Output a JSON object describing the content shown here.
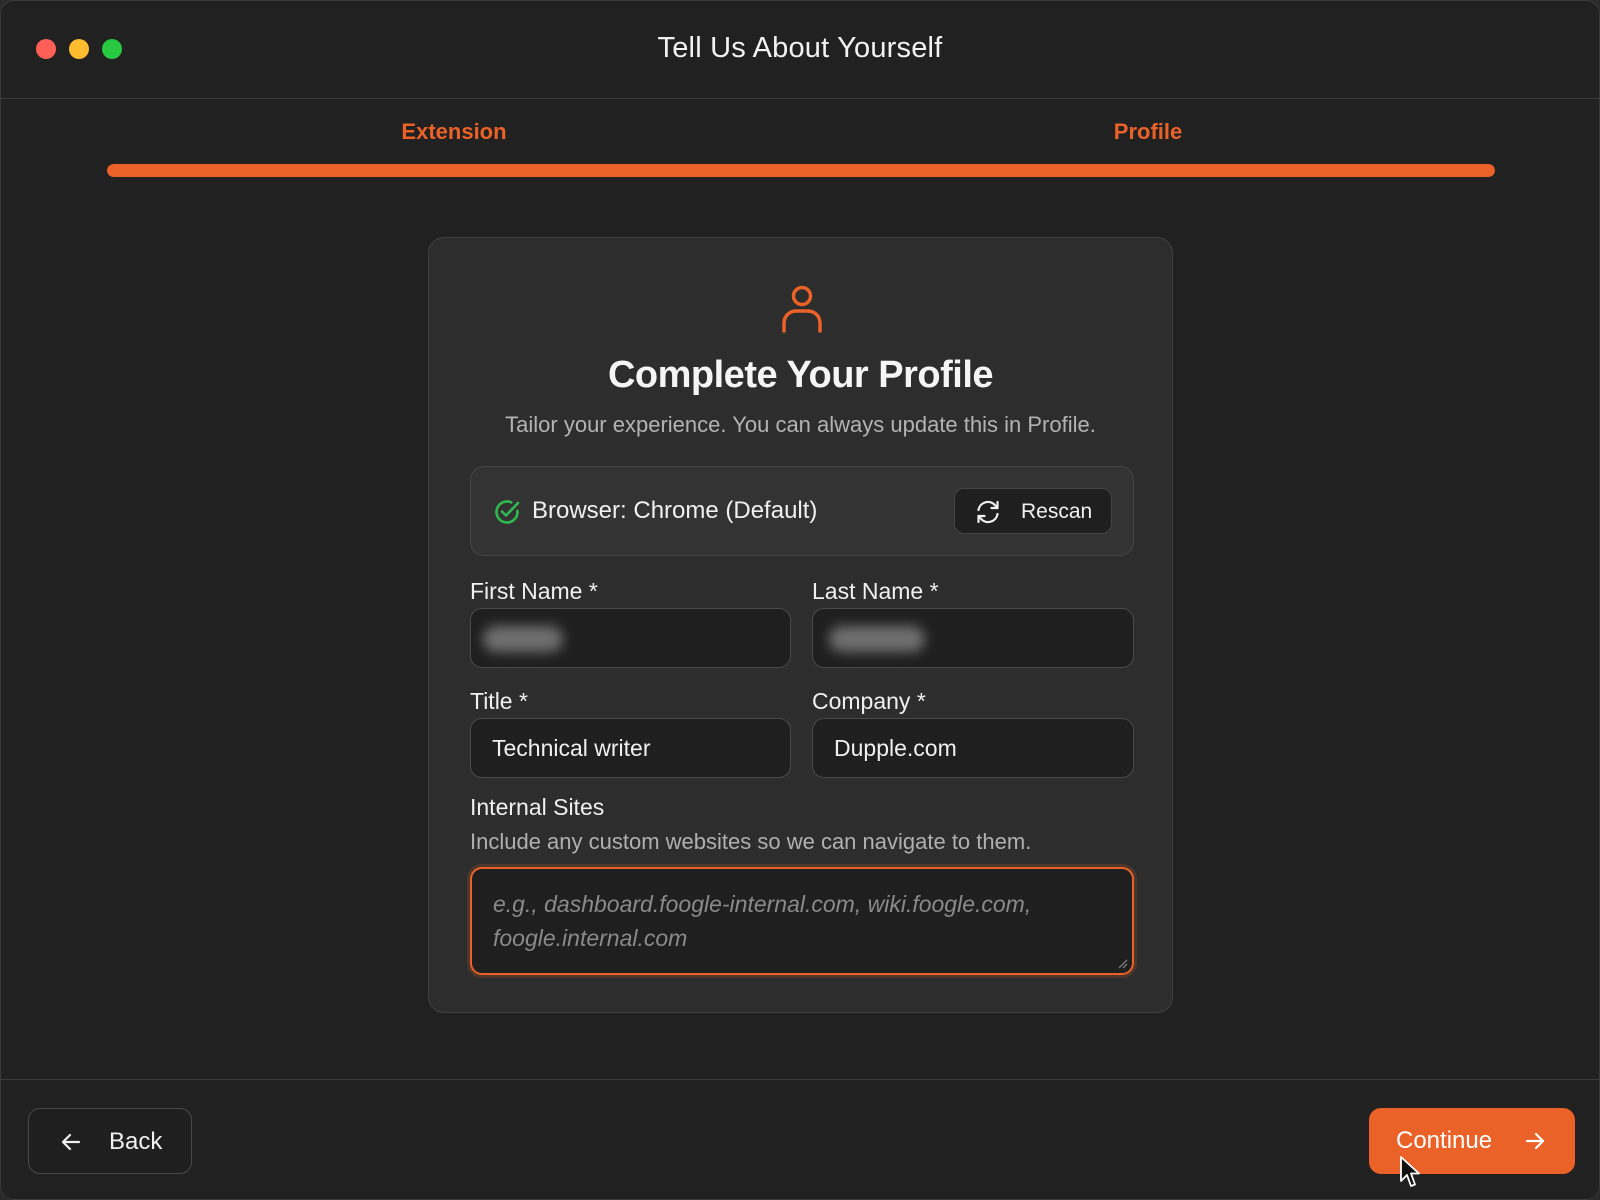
{
  "window": {
    "title": "Tell Us About Yourself"
  },
  "steps": [
    {
      "label": "Extension"
    },
    {
      "label": "Profile"
    }
  ],
  "progress": {
    "fraction": 1.0,
    "color": "#ea6227"
  },
  "card": {
    "icon": "user-icon",
    "title": "Complete Your Profile",
    "subtitle": "Tailor your experience. You can always update this in Profile.",
    "browser": {
      "status_icon": "check-circle-icon",
      "label": "Browser: Chrome (Default)",
      "rescan_icon": "refresh-icon",
      "rescan_label": "Rescan"
    },
    "fields": {
      "first_name": {
        "label": "First Name *",
        "value_hidden": true
      },
      "last_name": {
        "label": "Last Name *",
        "value_hidden": true
      },
      "title": {
        "label": "Title *",
        "value": "Technical writer"
      },
      "company": {
        "label": "Company *",
        "value": "Dupple.com"
      },
      "internal_sites": {
        "label": "Internal Sites",
        "helper": "Include any custom websites so we can navigate to them.",
        "placeholder": "e.g., dashboard.foogle-internal.com, wiki.foogle.com, foogle.internal.com",
        "value": ""
      }
    }
  },
  "footer": {
    "back_label": "Back",
    "back_icon": "arrow-left-icon",
    "continue_label": "Continue",
    "continue_icon": "arrow-right-icon"
  },
  "colors": {
    "accent": "#ea6227",
    "background": "#212121",
    "card": "#2d2d2d",
    "success": "#2fb84f"
  }
}
